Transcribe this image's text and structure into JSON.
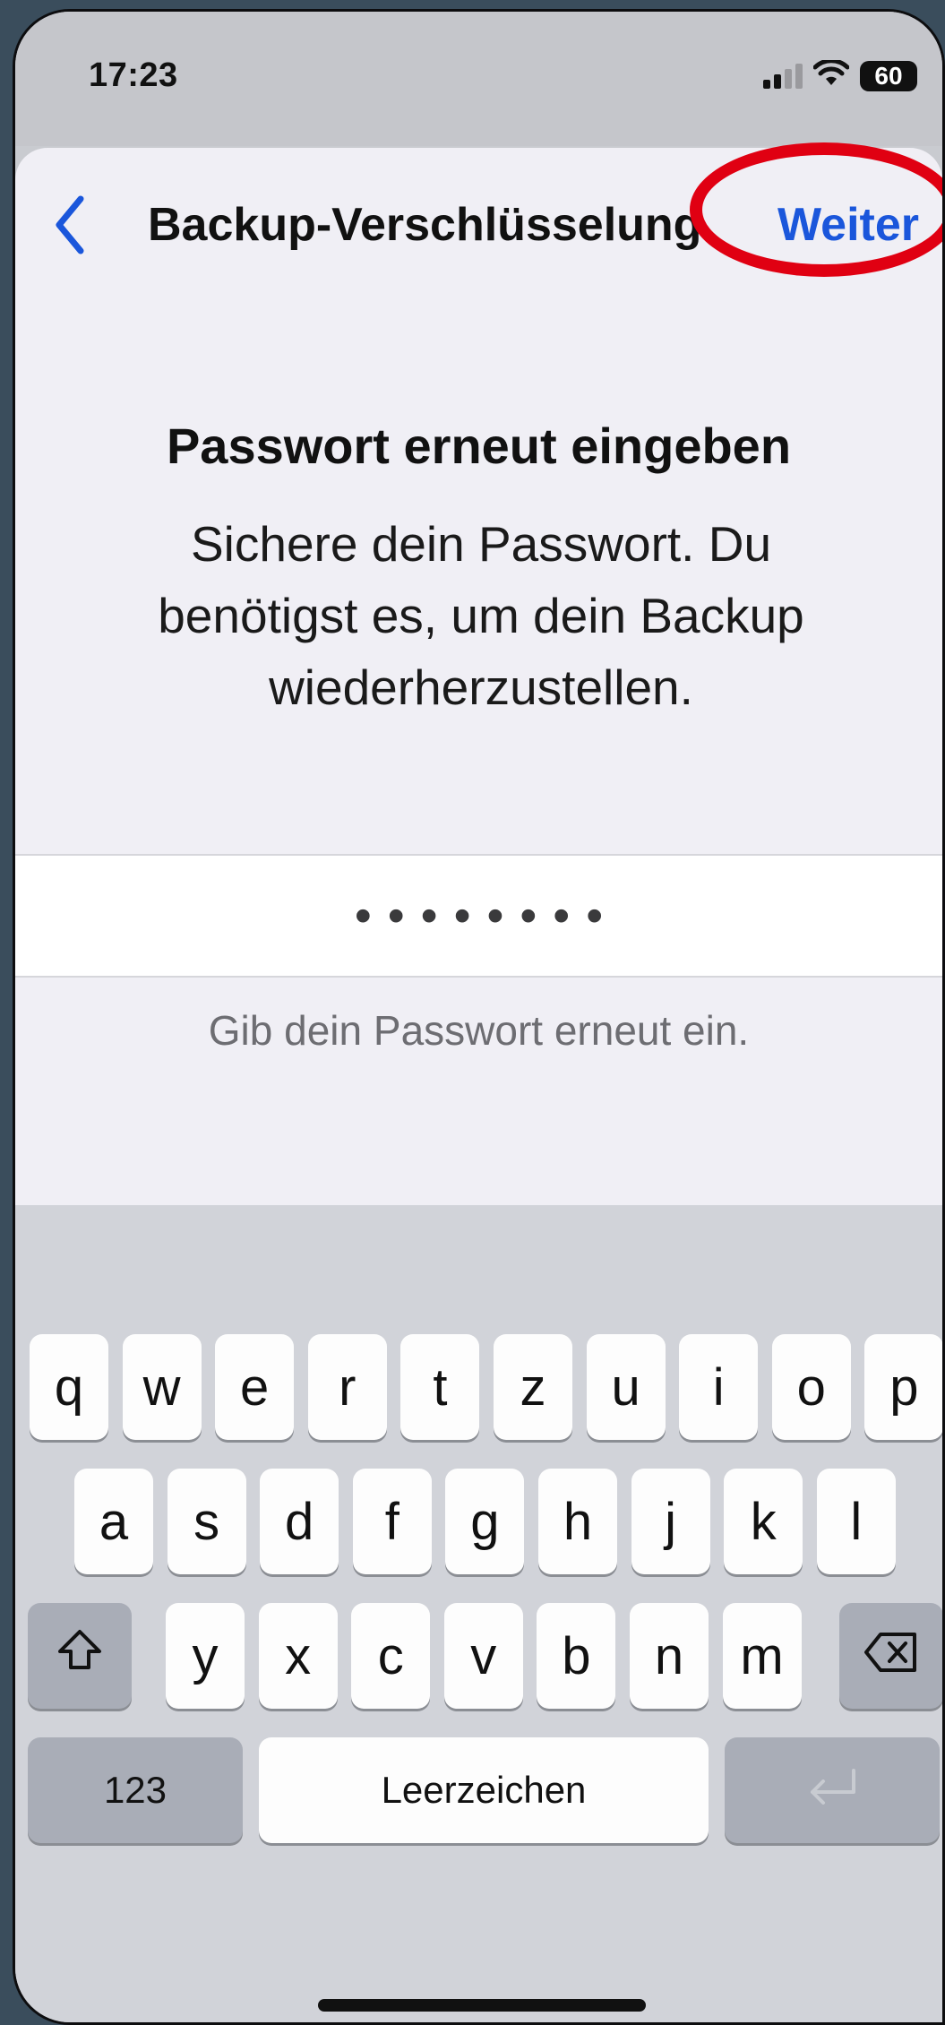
{
  "status": {
    "time": "17:23",
    "battery": "60"
  },
  "nav": {
    "title": "Backup-Verschlüsselung",
    "next_label": "Weiter"
  },
  "content": {
    "headline": "Passwort erneut eingeben",
    "subtext": "Sichere dein Passwort. Du benötigst es, um dein Backup wiederherzustellen.",
    "password_dots": "••••••••",
    "hint": "Gib dein Passwort erneut ein."
  },
  "keyboard": {
    "row1": [
      "q",
      "w",
      "e",
      "r",
      "t",
      "z",
      "u",
      "i",
      "o",
      "p"
    ],
    "row2": [
      "a",
      "s",
      "d",
      "f",
      "g",
      "h",
      "j",
      "k",
      "l"
    ],
    "row3": [
      "y",
      "x",
      "c",
      "v",
      "b",
      "n",
      "m"
    ],
    "numbers_label": "123",
    "space_label": "Leerzeichen"
  },
  "colors": {
    "accent": "#1a56db",
    "annotation": "#e00012"
  },
  "icons": [
    "chevron-left-icon",
    "signal-icon",
    "wifi-icon",
    "battery-icon",
    "shift-icon",
    "delete-icon",
    "return-icon"
  ]
}
